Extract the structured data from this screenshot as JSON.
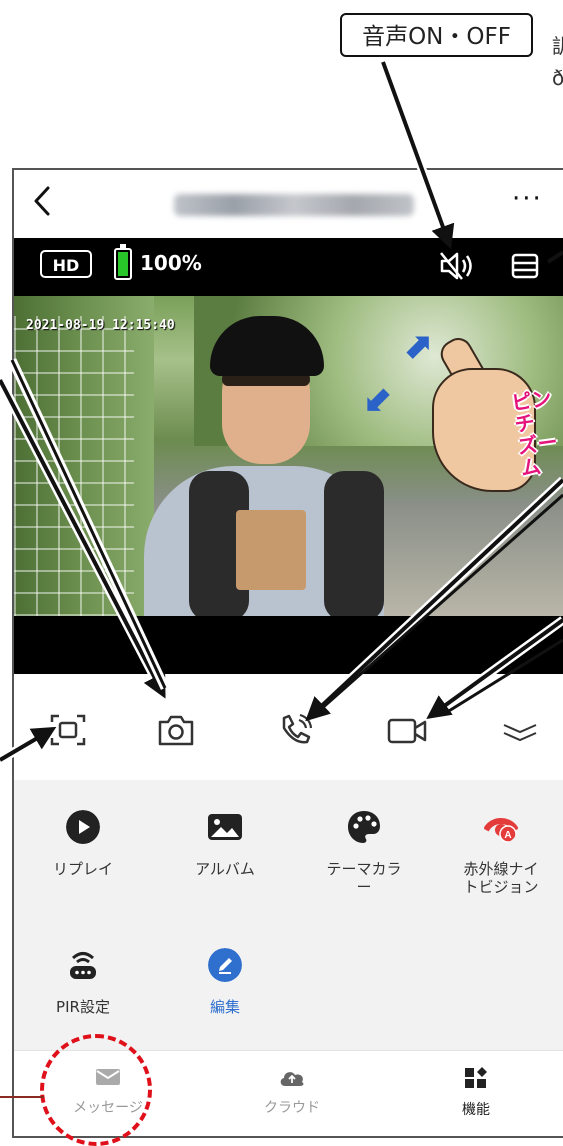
{
  "annotation": {
    "sound_callout": "音声ON・OFF",
    "side_note_line1": "訓",
    "side_note_line2": "ð",
    "pinch_label_line1": "ピンチ",
    "pinch_label_line2": "ズーム"
  },
  "header": {
    "back_icon": "chevron-left-icon",
    "title": "",
    "more_label": "···"
  },
  "stream_status": {
    "quality_badge": "HD",
    "battery_percent": "100%",
    "battery_level": 1.0,
    "battery_color": "#28c628",
    "mute_icon": "speaker-muted-icon",
    "layout_icon": "split-view-icon"
  },
  "video": {
    "timestamp": "2021-08-19  12:15:40"
  },
  "controls": [
    {
      "name": "screenshot-frame-icon"
    },
    {
      "name": "camera-icon"
    },
    {
      "name": "call-icon"
    },
    {
      "name": "video-record-icon"
    },
    {
      "name": "collapse-chevron-icon"
    }
  ],
  "features": [
    {
      "label": "リプレイ",
      "icon": "play-icon"
    },
    {
      "label": "アルバム",
      "icon": "album-icon"
    },
    {
      "label": "テーマカラー",
      "icon": "palette-icon"
    },
    {
      "label": "赤外線ナイトビジョン",
      "icon": "night-vision-icon"
    },
    {
      "label": "PIR設定",
      "icon": "pir-sensor-icon"
    },
    {
      "label": "編集",
      "icon": "edit-icon"
    }
  ],
  "feature_label_lines": {
    "theme": [
      "テーマカラ",
      "ー"
    ],
    "night": [
      "赤外線ナイ",
      "トビジョン"
    ]
  },
  "tabs": [
    {
      "label": "メッセージ",
      "icon": "mail-icon"
    },
    {
      "label": "クラウド",
      "icon": "cloud-icon"
    },
    {
      "label": "機能",
      "icon": "grid-icon"
    }
  ],
  "colors": {
    "accent_blue": "#2f6fce",
    "callout_red": "#e0101b",
    "pinch_pink": "#e5147a"
  }
}
